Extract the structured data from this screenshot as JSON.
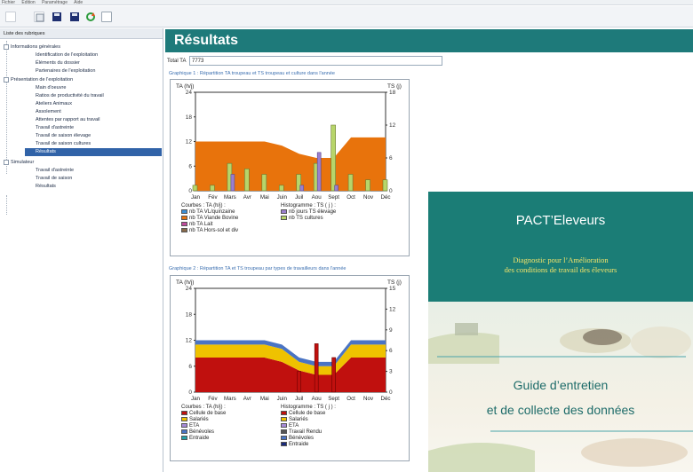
{
  "menubar": {
    "items": [
      "Fichier",
      "Édition",
      "Paramétrage",
      "Aide"
    ]
  },
  "toolbar": {
    "buttons": [
      "new-icon",
      "open-icon",
      "save-icon",
      "save-as-icon",
      "refresh-icon",
      "window-icon"
    ]
  },
  "sidebar": {
    "title": "Liste des rubriques",
    "items": [
      {
        "label": "Informations générales",
        "level": 0
      },
      {
        "label": "Identification de l'exploitation",
        "level": 1
      },
      {
        "label": "Éléments du dossier",
        "level": 1
      },
      {
        "label": "Partenaires de l'exploitation",
        "level": 1
      },
      {
        "label": "Présentation de l'exploitation",
        "level": 0
      },
      {
        "label": "Main d'oeuvre",
        "level": 1
      },
      {
        "label": "Ratios de productivité du travail",
        "level": 1
      },
      {
        "label": "Ateliers Animaux",
        "level": 1
      },
      {
        "label": "Assolement",
        "level": 1
      },
      {
        "label": "Attentes par rapport au travail",
        "level": 1
      },
      {
        "label": "Travail d'astreinte",
        "level": 1
      },
      {
        "label": "Travail de saison élevage",
        "level": 1
      },
      {
        "label": "Travail de saison cultures",
        "level": 1
      },
      {
        "label": "Résultats",
        "level": 1,
        "selected": true
      },
      {
        "label": "Simulateur",
        "level": 0
      },
      {
        "label": "Travail d'astreinte",
        "level": 1
      },
      {
        "label": "Travail de saison",
        "level": 1
      },
      {
        "label": "Résultats",
        "level": 1
      }
    ]
  },
  "main": {
    "title": "Résultats",
    "total_label": "Total TA",
    "total_value": "7773"
  },
  "graph1": {
    "title": "Graphique 1 : Répartition TA troupeau et TS troupeau et culture dans l'année"
  },
  "graph2": {
    "title": "Graphique 2 : Répartition TA et TS troupeau par types de travailleurs dans l'année"
  },
  "chart_data": [
    {
      "type": "area",
      "left_axis_label": "TA (h/j)",
      "right_axis_label": "TS (j)",
      "yticks_left": [
        "24",
        "18",
        "12",
        "6",
        "0"
      ],
      "yticks_right": [
        "18",
        "12",
        "6",
        "0"
      ],
      "ylim_left": [
        0,
        24
      ],
      "ylim_right": [
        0,
        18
      ],
      "months": [
        "Jan",
        "Fév",
        "Mars",
        "Avr",
        "Mai",
        "Juin",
        "Juil",
        "Aou",
        "Sept",
        "Oct",
        "Nov",
        "Déc"
      ],
      "legend_left_title": "Courbes : TA (h/j) :",
      "legend_right_title": "Histogramme : TS ( j ) :",
      "legend_left": [
        {
          "label": "nb TA VL/quinzaine",
          "color": "#3b8fd6"
        },
        {
          "label": "nb TA Viande Bovine",
          "color": "#e8730c"
        },
        {
          "label": "nb TA Lait",
          "color": "#c04a9c"
        },
        {
          "label": "nb TA Hors-sol et div",
          "color": "#8a6a4a"
        }
      ],
      "legend_right": [
        {
          "label": "nb jours TS élevage",
          "color": "#9a7fcf"
        },
        {
          "label": "nb TS cultures",
          "color": "#b7d56a"
        }
      ],
      "series": [
        {
          "name": "nb TA Viande Bovine",
          "values": [
            12,
            12,
            12,
            12,
            12,
            11,
            9,
            8,
            8,
            13,
            13,
            13
          ]
        },
        {
          "name": "nb TS cultures",
          "values": [
            1,
            1,
            5,
            4,
            3,
            1,
            3,
            5,
            12,
            3,
            2,
            2
          ]
        },
        {
          "name": "nb jours TS élevage",
          "values": [
            0,
            0,
            3,
            0,
            0,
            0,
            1,
            7,
            1,
            0,
            0,
            0
          ]
        }
      ]
    },
    {
      "type": "area",
      "left_axis_label": "TA (h/j)",
      "right_axis_label": "TS (j)",
      "yticks_left": [
        "24",
        "18",
        "12",
        "6",
        "0"
      ],
      "yticks_right": [
        "15",
        "12",
        "9",
        "6",
        "3",
        "0"
      ],
      "ylim_left": [
        0,
        24
      ],
      "ylim_right": [
        0,
        15
      ],
      "months": [
        "Jan",
        "Fév",
        "Mars",
        "Avr",
        "Mai",
        "Juin",
        "Juil",
        "Aou",
        "Sept",
        "Oct",
        "Nov",
        "Déc"
      ],
      "legend_left_title": "Courbes : TA (h/j) :",
      "legend_right_title": "Histogramme : TS ( j ) :",
      "legend_left": [
        {
          "label": "Cellule de base",
          "color": "#c0100e"
        },
        {
          "label": "Salariés",
          "color": "#efc200"
        },
        {
          "label": "ETA",
          "color": "#a78ad8"
        },
        {
          "label": "Bénévoles",
          "color": "#4a74c4"
        },
        {
          "label": "Entraide",
          "color": "#22a0a8"
        }
      ],
      "legend_right": [
        {
          "label": "Cellule de base",
          "color": "#c0100e"
        },
        {
          "label": "Salariés",
          "color": "#efc200"
        },
        {
          "label": "ETA",
          "color": "#a78ad8"
        },
        {
          "label": "Travail Rendu",
          "color": "#555555"
        },
        {
          "label": "Bénévoles",
          "color": "#4a74c4"
        },
        {
          "label": "Entraide",
          "color": "#1a2a7a"
        }
      ],
      "series": [
        {
          "name": "Cellule de base",
          "values": [
            8,
            8,
            8,
            8,
            8,
            7,
            5,
            4,
            4,
            8,
            8,
            8
          ]
        },
        {
          "name": "Salariés",
          "values": [
            3,
            3,
            3,
            3,
            3,
            3,
            2,
            2,
            2,
            3,
            3,
            3
          ]
        },
        {
          "name": "Bénévoles",
          "values": [
            1,
            1,
            1,
            1,
            1,
            1,
            1,
            1,
            1,
            1,
            1,
            1
          ]
        },
        {
          "name": "TS Cellule de base",
          "values": [
            0,
            0,
            0,
            0,
            0,
            0,
            3,
            7,
            5,
            0,
            0,
            0
          ]
        }
      ]
    }
  ],
  "brochure": {
    "title": "PACT’Eleveurs",
    "subtitle_line1": "Diagnostic pour l’Amélioration",
    "subtitle_line2": "des conditions de travail des éleveurs",
    "guide_line1": "Guide d’entretien",
    "guide_line2": "et de collecte des données",
    "colors": {
      "teal": "#1b7d76",
      "yellow": "#f2e36a"
    }
  }
}
